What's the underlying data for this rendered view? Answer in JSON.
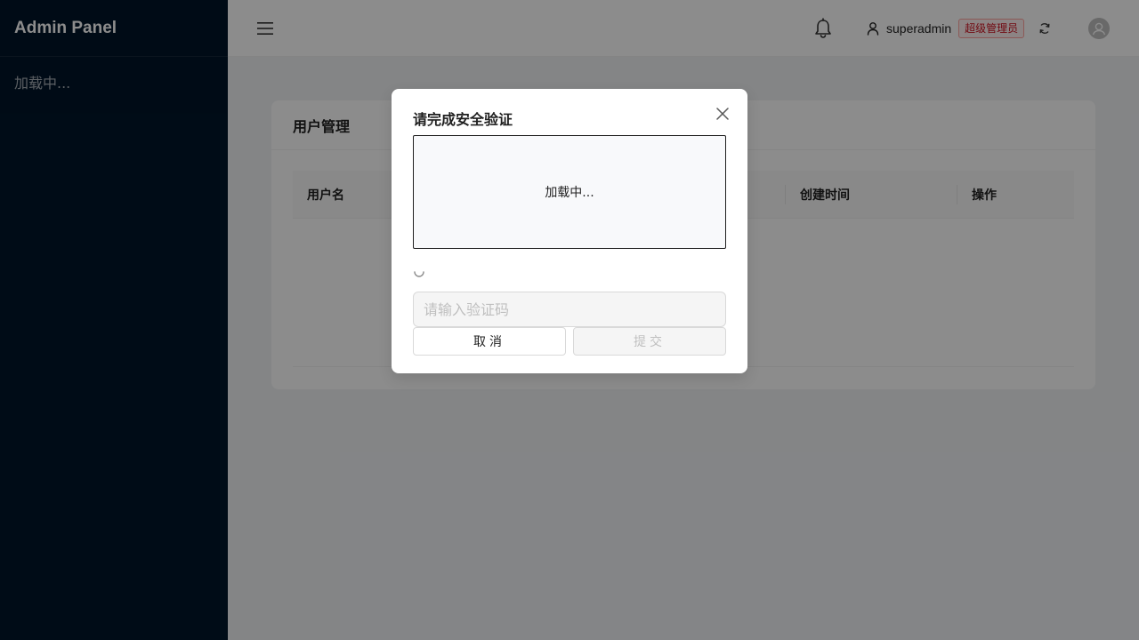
{
  "sidebar": {
    "brand": "Admin Panel",
    "loading_text": "加载中..."
  },
  "header": {
    "menu_icon": "menu-icon",
    "bell_icon": "bell-icon",
    "user": {
      "icon": "user-icon",
      "name": "superadmin",
      "role_badge": "超级管理员"
    },
    "refresh_icon": "refresh-icon",
    "avatar_icon": "avatar-icon"
  },
  "card": {
    "title": "用户管理",
    "table": {
      "columns": [
        "用户名",
        "创建时间",
        "操作"
      ]
    }
  },
  "modal": {
    "title": "请完成安全验证",
    "captcha_loading": "加载中...",
    "code_input_placeholder": "请输入验证码",
    "code_input_value": "",
    "cancel_label": "取消",
    "submit_label": "提交"
  },
  "colors": {
    "sidebar_bg": "#001529",
    "badge_text": "#cf1322",
    "badge_bg": "#fff1f0",
    "badge_border": "#ffa39e"
  }
}
